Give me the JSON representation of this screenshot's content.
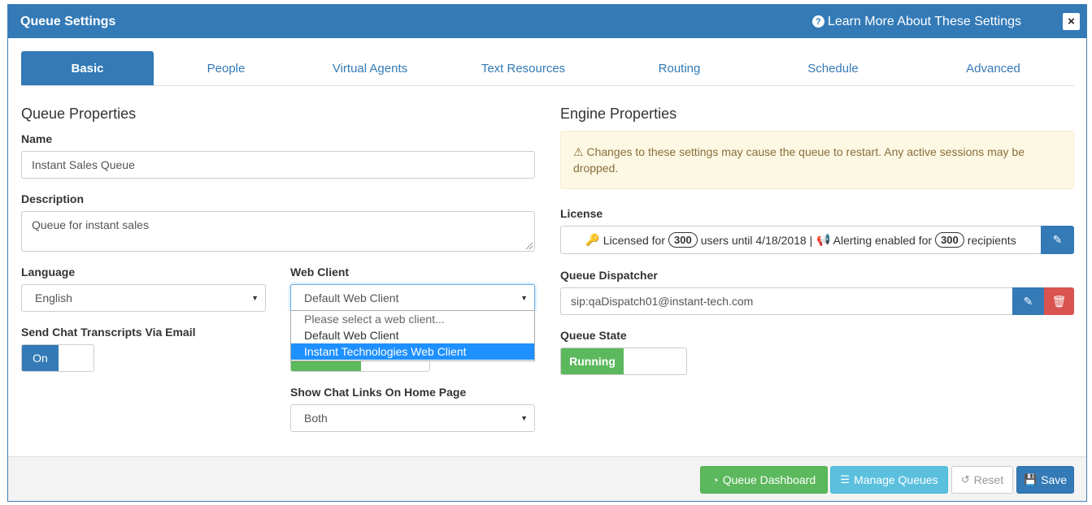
{
  "header": {
    "title": "Queue Settings",
    "learn_more": "Learn More About These Settings",
    "close": "×"
  },
  "tabs": [
    {
      "label": "Basic",
      "active": true
    },
    {
      "label": "People"
    },
    {
      "label": "Virtual Agents"
    },
    {
      "label": "Text Resources"
    },
    {
      "label": "Routing"
    },
    {
      "label": "Schedule"
    },
    {
      "label": "Advanced"
    }
  ],
  "queue_properties": {
    "title": "Queue Properties",
    "name_label": "Name",
    "name_value": "Instant Sales Queue",
    "description_label": "Description",
    "description_value": "Queue for instant sales",
    "language_label": "Language",
    "language_value": "English",
    "web_client_label": "Web Client",
    "web_client_value": "Default Web Client",
    "web_client_options": [
      "Please select a web client...",
      "Default Web Client",
      "Instant Technologies Web Client"
    ],
    "transcripts_label": "Send Chat Transcripts Via Email",
    "transcripts_toggle": "On",
    "chat_links_label": "Show Chat Links On Home Page",
    "chat_links_value": "Both"
  },
  "engine_properties": {
    "title": "Engine Properties",
    "warning": "Changes to these settings may cause the queue to restart. Any active sessions may be dropped.",
    "license_label": "License",
    "license_text_1": "Licensed for",
    "license_users": "300",
    "license_text_2": "users until 4/18/2018 |",
    "license_text_3": "Alerting enabled for",
    "license_recipients": "300",
    "license_text_4": "recipients",
    "dispatcher_label": "Queue Dispatcher",
    "dispatcher_value": "sip:qaDispatch01@instant-tech.com",
    "state_label": "Queue State",
    "state_value": "Running"
  },
  "footer": {
    "dashboard": "Queue Dashboard",
    "manage": "Manage Queues",
    "reset": "Reset",
    "save": "Save"
  },
  "colors": {
    "primary": "#337ab7",
    "success": "#5cb85c",
    "info": "#5bc0de",
    "danger": "#d9534f",
    "warning_bg": "#fcf8e3"
  }
}
